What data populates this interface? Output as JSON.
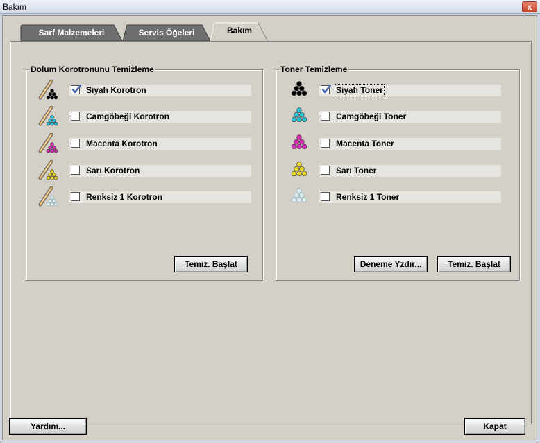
{
  "window": {
    "title": "Bakım",
    "close_label": "x"
  },
  "tabs": [
    {
      "label": "Sarf Malzemeleri",
      "active": false
    },
    {
      "label": "Servis Öğeleri",
      "active": false
    },
    {
      "label": "Bakım",
      "active": true
    }
  ],
  "corotron_group": {
    "title": "Dolum Korotronunu Temizleme",
    "items": [
      {
        "label": "Siyah Korotron",
        "checked": true,
        "color": "#000000",
        "icon": "corotron-black-icon"
      },
      {
        "label": "Camgöbeği Korotron",
        "checked": false,
        "color": "#2ec4d8",
        "icon": "corotron-cyan-icon"
      },
      {
        "label": "Macenta Korotron",
        "checked": false,
        "color": "#d62ab5",
        "icon": "corotron-magenta-icon"
      },
      {
        "label": "Sarı Korotron",
        "checked": false,
        "color": "#e8d62a",
        "icon": "corotron-yellow-icon"
      },
      {
        "label": "Renksiz 1 Korotron",
        "checked": false,
        "color": "#d8ecef",
        "icon": "corotron-clear-icon"
      }
    ],
    "start_button": "Temiz. Başlat"
  },
  "toner_group": {
    "title": "Toner Temizleme",
    "items": [
      {
        "label": "Siyah Toner",
        "checked": true,
        "color": "#000000",
        "icon": "toner-black-icon"
      },
      {
        "label": "Camgöbeği Toner",
        "checked": false,
        "color": "#2ec4d8",
        "icon": "toner-cyan-icon"
      },
      {
        "label": "Macenta Toner",
        "checked": false,
        "color": "#d62ab5",
        "icon": "toner-magenta-icon"
      },
      {
        "label": "Sarı Toner",
        "checked": false,
        "color": "#e8d62a",
        "icon": "toner-yellow-icon"
      },
      {
        "label": "Renksiz 1 Toner",
        "checked": false,
        "color": "#d8ecef",
        "icon": "toner-clear-icon"
      }
    ],
    "test_print_button": "Deneme Yzdır...",
    "start_button": "Temiz. Başlat"
  },
  "footer": {
    "help_button": "Yardım...",
    "close_button": "Kapat"
  }
}
